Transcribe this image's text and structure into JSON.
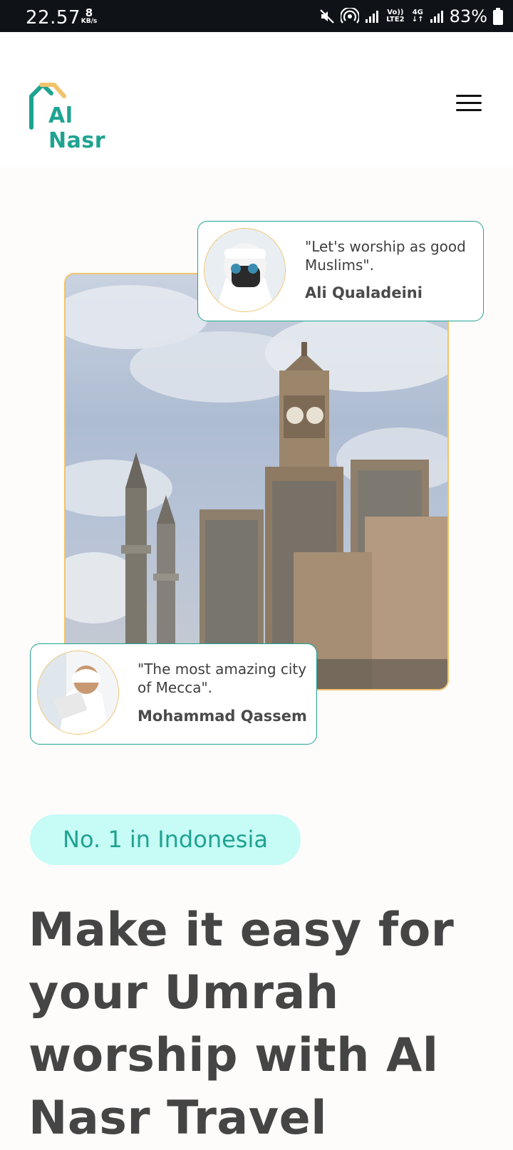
{
  "status_bar": {
    "time": "22.57",
    "net_speed_value": "8",
    "net_speed_unit": "KB/s",
    "volte_label": "Vo)) LTE2",
    "network_type": "4G",
    "battery_percent": "83%",
    "icons": [
      "mute-icon",
      "hotspot-icon",
      "signal-icon",
      "signal-icon",
      "battery-icon"
    ]
  },
  "header": {
    "logo_text": "Al Nasr",
    "menu_icon": "hamburger-menu-icon"
  },
  "colors": {
    "brand_teal": "#1fa391",
    "accent_gold": "#f0c36d",
    "badge_bg": "#c6fbf6",
    "heading_text": "#454545"
  },
  "testimonials": [
    {
      "quote": "\"Let's worship as good Muslims\".",
      "author": "Ali Qualadeini"
    },
    {
      "quote": "\"The most amazing city of Mecca\".",
      "author": "Mohammad Qassem"
    }
  ],
  "hero": {
    "badge": "No. 1 in Indonesia",
    "headline": "Make it easy for your Umrah worship with Al Nasr Travel"
  }
}
